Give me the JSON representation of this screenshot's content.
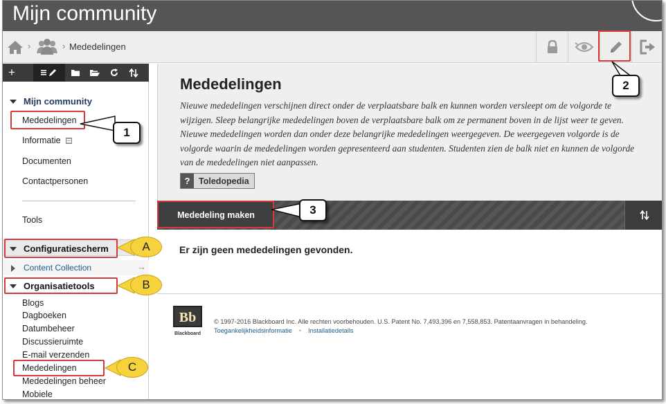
{
  "header": {
    "title": "Mijn community"
  },
  "breadcrumb": {
    "current": "Mededelingen",
    "separator": "›"
  },
  "toolbar_icons": [
    "home-icon",
    "people-icon",
    "lock-icon",
    "eye-icon",
    "pencil-icon",
    "exit-icon"
  ],
  "left_panel": {
    "section_title": "Mijn community",
    "items": [
      "Mededelingen",
      "Informatie",
      "Documenten",
      "Contactpersonen"
    ],
    "tools_label": "Tools",
    "config_title": "Configuratiescherm",
    "content_collection": "Content Collection",
    "content_collection_arrow": "→",
    "org_title": "Organisatietools",
    "org_items": [
      "Blogs",
      "Dagboeken",
      "Datumbeheer",
      "Discussieruimte",
      "E-mail verzenden",
      "Mededelingen",
      "Mededelingen beheer",
      "Mobiele"
    ]
  },
  "main": {
    "title": "Mededelingen",
    "description": "Nieuwe mededelingen verschijnen direct onder de verplaatsbare balk en kunnen worden versleept om de volgorde te wijzigen. Sleep belangrijke mededelingen boven de verplaatsbare balk om ze permanent boven in de lijst weer te geven. Nieuwe mededelingen worden dan onder deze belangrijke mededelingen weergegeven. De weergegeven volgorde is de volgorde waarin de mededelingen worden gepresenteerd aan studenten. Studenten zien de balk niet en kunnen de volgorde van de mededelingen niet aanpassen.",
    "help_q": "?",
    "help_label": "Toledopedia",
    "create_button": "Mededeling maken",
    "empty_message": "Er zijn geen mededelingen gevonden."
  },
  "footer": {
    "logo_text": "Bb",
    "logo_caption": "Blackboard",
    "copyright": "© 1997-2016 Blackboard Inc. Alle rechten voorbehouden. U.S. Patent No. 7,493,396 en 7,558,853. Patentaanvragen in behandeling.",
    "links": [
      "Toegankelijkheidsinformatie",
      "Installatiedetails"
    ]
  },
  "callouts": {
    "one": "1",
    "two": "2",
    "three": "3",
    "a": "A",
    "b": "B",
    "c": "C"
  },
  "colors": {
    "highlight": "#d9383a",
    "callout_yellow": "#f6d23d",
    "title_bar": "#555555",
    "link_blue": "#1d5a86"
  }
}
